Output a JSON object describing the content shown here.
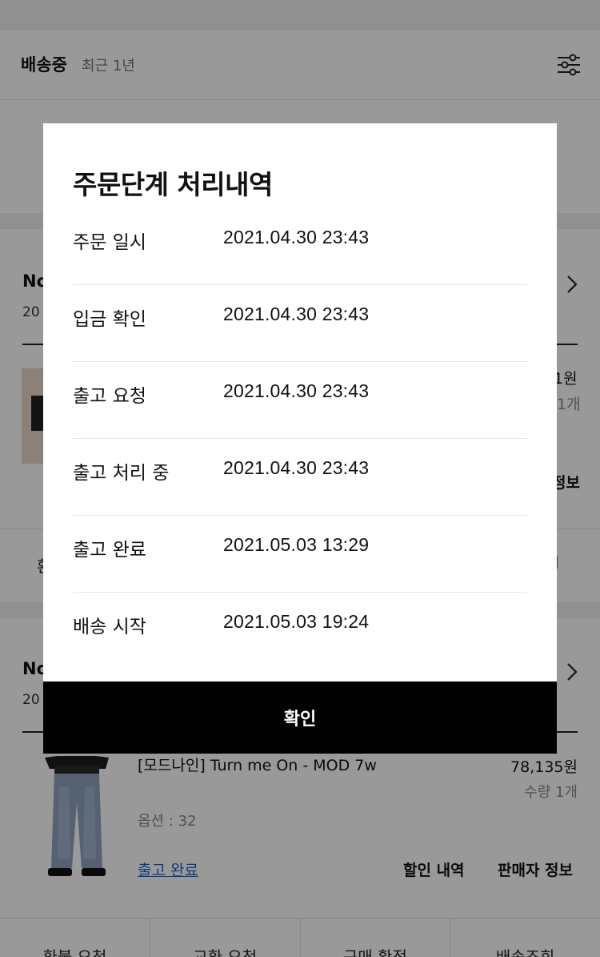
{
  "filter": {
    "title": "배송중",
    "period": "최근 1년"
  },
  "orders": [
    {
      "order_no_partial": "No",
      "order_date_partial": "20",
      "price_partial": "1원",
      "qty_partial": "1개",
      "seller_partial": "정보"
    },
    {
      "order_no_partial": "No",
      "order_date_partial": "20",
      "product_name": "[모드나인] Turn me On - MOD 7w",
      "option": "옵션 : 32",
      "status": "출고 완료",
      "price": "78,135원",
      "qty": "수량 1개",
      "discount_label": "할인 내역",
      "seller_label": "판매자 정보"
    }
  ],
  "row_actions_partial": {
    "left": "환",
    "right": "l"
  },
  "bottom_actions": [
    "환불 요청",
    "교환 요청",
    "구매 확정",
    "배송조회"
  ],
  "modal": {
    "title": "주문단계 처리내역",
    "steps": [
      {
        "label": "주문 일시",
        "time": "2021.04.30 23:43"
      },
      {
        "label": "입금 확인",
        "time": "2021.04.30 23:43"
      },
      {
        "label": "출고 요청",
        "time": "2021.04.30 23:43"
      },
      {
        "label": "출고 처리 중",
        "time": "2021.04.30 23:43"
      },
      {
        "label": "출고 완료",
        "time": "2021.05.03 13:29"
      },
      {
        "label": "배송 시작",
        "time": "2021.05.03 19:24"
      }
    ],
    "confirm_label": "확인"
  },
  "colors": {
    "link": "#1a5fd1",
    "confirm_bg": "#000000",
    "overlay": "rgba(0,0,0,0.40)"
  }
}
